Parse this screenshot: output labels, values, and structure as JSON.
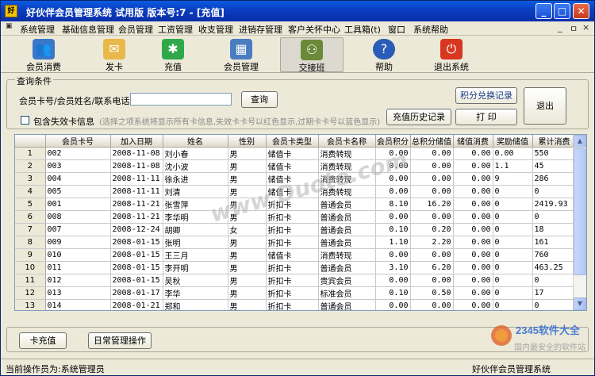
{
  "window": {
    "title": "好伙伴会员管理系统 试用版   版本号:7 - [充值]",
    "app_icon": "app-icon"
  },
  "menu": [
    "系统管理",
    "基础信息管理",
    "会员管理",
    "工资管理",
    "收支管理",
    "进销存管理",
    "客户关怀中心",
    "工具箱(t)",
    "窗口",
    "系统帮助"
  ],
  "mdi_controls": [
    "_",
    "ㅁ",
    "×"
  ],
  "toolbar": [
    {
      "label": "会员消费",
      "icon": "members-consume-icon",
      "color": "#3a78c9",
      "glyph": "👥"
    },
    {
      "label": "发卡",
      "icon": "issue-card-icon",
      "color": "#e8b84a",
      "glyph": "✉"
    },
    {
      "label": "充值",
      "icon": "recharge-icon",
      "color": "#2fa84a",
      "glyph": "✱"
    },
    {
      "label": "会员管理",
      "icon": "member-management-icon",
      "color": "#4a7cc0",
      "glyph": "▦"
    },
    {
      "label": "交接班",
      "icon": "shift-handover-icon",
      "color": "#6a8a3a",
      "glyph": "⚇"
    },
    {
      "label": "帮助",
      "icon": "help-icon",
      "color": "#2a5cb8",
      "glyph": "?"
    },
    {
      "label": "退出系统",
      "icon": "exit-icon",
      "color": "#d8361f",
      "glyph": "⏻"
    }
  ],
  "query": {
    "legend": "查询条件",
    "search_label": "会员卡号/会员姓名/联系电话:",
    "search_value": "",
    "search_button": "查询",
    "include_invalid_label": "包含失效卡信息",
    "include_invalid_checked": false,
    "hint": "(选择之项系统将显示所有卡信息,失效卡卡号以红色显示,过期卡卡号以蓝色显示)",
    "points_button": "积分兑换记录",
    "print_button": "打 印",
    "history_button": "充值历史记录",
    "exit_button": "退出"
  },
  "table": {
    "columns": [
      "会员卡号",
      "加入日期",
      "姓名",
      "性别",
      "会员卡类型",
      "会员卡名称",
      "会员积分",
      "总积分储值",
      "储值消费",
      "奖励储值",
      "累计消费"
    ],
    "rows": [
      [
        "1",
        "002",
        "2008-11-08",
        "刘小春",
        "男",
        "储值卡",
        "消费转现",
        "0.00",
        "0.00",
        "0.00",
        "0.00",
        "550"
      ],
      [
        "2",
        "003",
        "2008-11-08",
        "沈小波",
        "男",
        "储值卡",
        "消费转现",
        "0.00",
        "0.00",
        "0.00",
        "1.1",
        "45"
      ],
      [
        "3",
        "004",
        "2008-11-11",
        "徐永进",
        "男",
        "储值卡",
        "消费转现",
        "0.00",
        "0.00",
        "0.00",
        "9",
        "286"
      ],
      [
        "4",
        "005",
        "2008-11-11",
        "刘清",
        "男",
        "储值卡",
        "消费转现",
        "0.00",
        "0.00",
        "0.00",
        "0",
        "0"
      ],
      [
        "5",
        "001",
        "2008-11-21",
        "张雪萍",
        "男",
        "折扣卡",
        "普通会员",
        "8.10",
        "16.20",
        "0.00",
        "0",
        "2419.93"
      ],
      [
        "6",
        "008",
        "2008-11-21",
        "李华明",
        "男",
        "折扣卡",
        "普通会员",
        "0.00",
        "0.00",
        "0.00",
        "0",
        "0"
      ],
      [
        "7",
        "007",
        "2008-12-24",
        "胡卿",
        "女",
        "折扣卡",
        "普通会员",
        "0.10",
        "0.20",
        "0.00",
        "0",
        "18"
      ],
      [
        "8",
        "009",
        "2008-01-15",
        "张明",
        "男",
        "折扣卡",
        "普通会员",
        "1.10",
        "2.20",
        "0.00",
        "0",
        "161"
      ],
      [
        "9",
        "010",
        "2008-01-15",
        "王三月",
        "男",
        "储值卡",
        "消费转现",
        "0.00",
        "0.00",
        "0.00",
        "0",
        "760"
      ],
      [
        "10",
        "011",
        "2008-01-15",
        "李开明",
        "男",
        "折扣卡",
        "普通会员",
        "3.10",
        "6.20",
        "0.00",
        "0",
        "463.25"
      ],
      [
        "11",
        "012",
        "2008-01-15",
        "吴秋",
        "男",
        "折扣卡",
        "贵宾会员",
        "0.00",
        "0.00",
        "0.00",
        "0",
        "0"
      ],
      [
        "12",
        "013",
        "2008-01-17",
        "李华",
        "男",
        "折扣卡",
        "标准会员",
        "0.10",
        "0.50",
        "0.00",
        "0",
        "17"
      ],
      [
        "13",
        "014",
        "2008-01-21",
        "郑和",
        "男",
        "折扣卡",
        "普通会员",
        "0.00",
        "0.00",
        "0.00",
        "0",
        "0"
      ],
      [
        "14",
        "015",
        "2008-01-21",
        "刘华",
        "男",
        "折扣卡",
        "标准会员",
        "0.00",
        "0.00",
        "0.00",
        "0",
        "0"
      ]
    ]
  },
  "bottom_buttons": [
    "卡充值",
    "日常管理操作"
  ],
  "status": {
    "operator": "当前操作员为:系统管理员",
    "app_name": "好伙伴会员管理系统"
  },
  "watermarks": {
    "center": "www.Duote.com",
    "logo": "2345软件大全",
    "logo_sub": "国内最安全的软件站"
  }
}
